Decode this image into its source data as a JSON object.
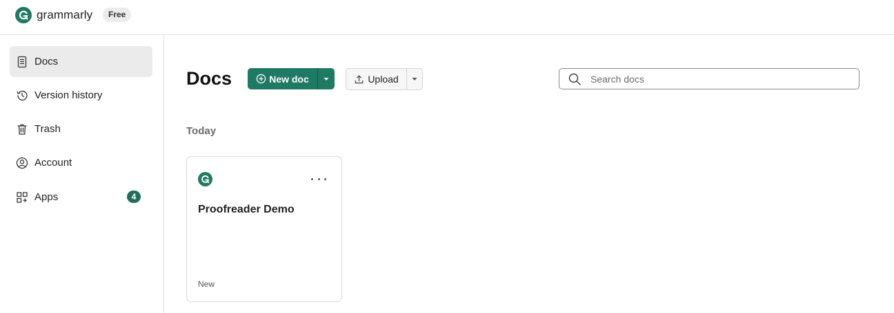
{
  "brand": {
    "name": "grammarly",
    "plan": "Free",
    "color": "#1f7a63"
  },
  "sidebar": {
    "items": [
      {
        "label": "Docs",
        "icon": "document-icon",
        "active": true
      },
      {
        "label": "Version history",
        "icon": "history-icon"
      },
      {
        "label": "Trash",
        "icon": "trash-icon"
      },
      {
        "label": "Account",
        "icon": "account-icon"
      },
      {
        "label": "Apps",
        "icon": "apps-icon",
        "count": "4"
      }
    ]
  },
  "main": {
    "title": "Docs",
    "new_doc_label": "New doc",
    "upload_label": "Upload",
    "search_placeholder": "Search docs",
    "section_label": "Today",
    "docs": [
      {
        "title": "Proofreader Demo",
        "status": "New"
      }
    ]
  }
}
